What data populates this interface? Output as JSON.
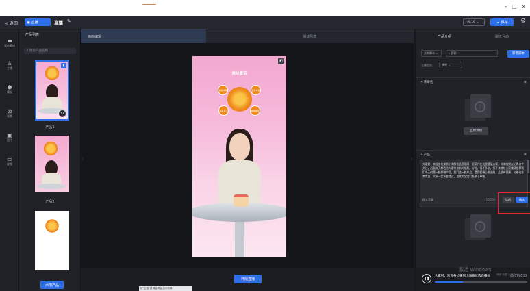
{
  "window": {
    "controls": "– □ ×"
  },
  "topbar": {
    "back_label": "< 返回",
    "badge_label": "直播",
    "project_name": "直播",
    "resolution": "9:16",
    "save_label": "保存"
  },
  "leftnav": {
    "items": [
      {
        "label": "我的素材",
        "icon": "folder-icon"
      },
      {
        "label": "主播",
        "icon": "person-icon"
      },
      {
        "label": "模板",
        "icon": "template-icon"
      },
      {
        "label": "背景",
        "icon": "background-icon"
      },
      {
        "label": "图片",
        "icon": "image-icon"
      },
      {
        "label": "视频",
        "icon": "video-icon"
      }
    ]
  },
  "products": {
    "title": "产品列表",
    "search_placeholder": "搜索产品名称",
    "items": [
      {
        "label": "产品1"
      },
      {
        "label": "产品2"
      },
      {
        "label": ""
      }
    ],
    "add_label": "添加产品"
  },
  "center": {
    "tabs": [
      {
        "label": "画面编辑"
      },
      {
        "label": "播放列表"
      }
    ],
    "canvas_title": "美味童话",
    "canvas_subtitle": "",
    "bubbles": [
      "新鲜水果",
      "营养丰富",
      "冰爽可口",
      "美味健康"
    ],
    "start_label": "开始直播",
    "hint_text": "按\"空格\"键 隐藏场景选中效果"
  },
  "right": {
    "tabs": [
      {
        "label": "产品介绍"
      },
      {
        "label": "聊天互动"
      }
    ],
    "filter_select": "文本脚本",
    "search_placeholder": "搜索",
    "new_script_label": "新增脚本",
    "host_label": "主播音色：",
    "host_select": "晓晓",
    "section_unnamed": "未命名",
    "add_now_label": "立即添加",
    "section_product": "产品1",
    "script_text": "大家好，欢迎各位来到小海豚优选直播间，很高兴在这里遇见大家，新来的朋友记得点个关注，后面每天都会给大家带来新的福利。好啦，话不多说，接下来就给大家重磅推荐我们今天的第一款好物产品。我们这一款产品，是我们精心挑选的，品质有保障，价格也非常实惠，大家一定不要错过，喜欢的宝宝们赶紧下单吧。",
    "voice_label": "插入音量",
    "counter": "156/200",
    "listen_label": "试听",
    "confirm_label": "确认",
    "watermark": "激活 Windows",
    "watermark_sub": "转到\"设置\"以激活 Windows。",
    "subtitle_text": "大家好，欢迎各位来到小海豚优选直播间",
    "time_text": "00:07/00:23",
    "progress": 0.3
  }
}
